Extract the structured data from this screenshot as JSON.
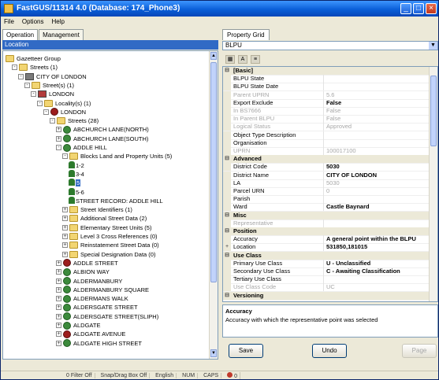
{
  "window": {
    "title": "FastGUS/11314 4.0 (Database: 174_Phone3)",
    "minimize": "_",
    "maximize": "□",
    "close": "×"
  },
  "menu": [
    "File",
    "Options",
    "Help"
  ],
  "left_tabs": [
    "Operation",
    "Management"
  ],
  "location_header": "Location",
  "tree": [
    {
      "d": 0,
      "pm": "",
      "icon": "folder",
      "label": "Gazetteer Group"
    },
    {
      "d": 1,
      "pm": "-",
      "icon": "folder",
      "label": "Streets (1)"
    },
    {
      "d": 2,
      "pm": "-",
      "icon": "house",
      "label": "CITY OF LONDON"
    },
    {
      "d": 3,
      "pm": "-",
      "icon": "folder",
      "label": "Street(s) (1)"
    },
    {
      "d": 4,
      "pm": "-",
      "icon": "house red",
      "label": "LONDON"
    },
    {
      "d": 5,
      "pm": "-",
      "icon": "folder",
      "label": "Locality(s) (1)"
    },
    {
      "d": 6,
      "pm": "-",
      "icon": "globe red",
      "label": "LONDON"
    },
    {
      "d": 7,
      "pm": "-",
      "icon": "folder",
      "label": "Streets (28)"
    },
    {
      "d": 8,
      "pm": "+",
      "icon": "globe",
      "label": "ABCHURCH LANE(NORTH)"
    },
    {
      "d": 8,
      "pm": "+",
      "icon": "globe",
      "label": "ABCHURCH LANE(SOUTH)"
    },
    {
      "d": 8,
      "pm": "-",
      "icon": "globe",
      "label": "ADDLE HILL"
    },
    {
      "d": 9,
      "pm": "-",
      "icon": "folder",
      "label": "Blocks Land and Property Units (5)"
    },
    {
      "d": 10,
      "pm": "+",
      "icon": "tree",
      "label": "1-2"
    },
    {
      "d": 10,
      "pm": "+",
      "icon": "tree",
      "label": "3-4"
    },
    {
      "d": 10,
      "pm": "+",
      "icon": "tree sel",
      "label": "5",
      "selected": true
    },
    {
      "d": 10,
      "pm": "+",
      "icon": "tree",
      "label": "5-6"
    },
    {
      "d": 10,
      "pm": "+",
      "icon": "tree",
      "label": "STREET RECORD: ADDLE HILL"
    },
    {
      "d": 9,
      "pm": "+",
      "icon": "folder",
      "label": "Street Identifiers (1)"
    },
    {
      "d": 9,
      "pm": "+",
      "icon": "folder",
      "label": "Additional Street Data (2)"
    },
    {
      "d": 9,
      "pm": "+",
      "icon": "folder",
      "label": "Elementary Street Units (5)"
    },
    {
      "d": 9,
      "pm": "+",
      "icon": "folder",
      "label": "Level 3 Cross References (0)"
    },
    {
      "d": 9,
      "pm": "+",
      "icon": "folder",
      "label": "Reinstatement Street Data (0)"
    },
    {
      "d": 9,
      "pm": "+",
      "icon": "folder",
      "label": "Special Designation Data (0)"
    },
    {
      "d": 8,
      "pm": "+",
      "icon": "globe red",
      "label": "ADDLE STREET"
    },
    {
      "d": 8,
      "pm": "+",
      "icon": "globe",
      "label": "ALBION WAY"
    },
    {
      "d": 8,
      "pm": "+",
      "icon": "globe",
      "label": "ALDERMANBURY"
    },
    {
      "d": 8,
      "pm": "+",
      "icon": "globe",
      "label": "ALDERMANBURY SQUARE"
    },
    {
      "d": 8,
      "pm": "+",
      "icon": "globe",
      "label": "ALDERMANS WALK"
    },
    {
      "d": 8,
      "pm": "+",
      "icon": "globe",
      "label": "ALDERSGATE STREET"
    },
    {
      "d": 8,
      "pm": "+",
      "icon": "globe",
      "label": "ALDERSGATE STREET(SLIPH)"
    },
    {
      "d": 8,
      "pm": "+",
      "icon": "globe",
      "label": "ALDGATE"
    },
    {
      "d": 8,
      "pm": "+",
      "icon": "globe red",
      "label": "ALDGATE AVENUE"
    },
    {
      "d": 8,
      "pm": "+",
      "icon": "globe",
      "label": "ALDGATE HIGH STREET"
    }
  ],
  "right_tab": "Property Grid",
  "selector": "BLPU",
  "grid_rows": [
    {
      "cat": true,
      "k": "[Basic]"
    },
    {
      "k": "BLPU State",
      "v": ""
    },
    {
      "k": "BLPU State Date",
      "v": ""
    },
    {
      "k": "Parent UPRN",
      "v": "5.6",
      "dimk": true,
      "dimv": true
    },
    {
      "k": "Export Exclude",
      "v": "False",
      "b": true
    },
    {
      "k": "In BS7666",
      "v": "False",
      "dimk": true,
      "dimv": true
    },
    {
      "k": "In Parent BLPU",
      "v": "False",
      "dimk": true,
      "dimv": true
    },
    {
      "k": "Logical Status",
      "v": "Approved",
      "dimk": true,
      "dimv": true
    },
    {
      "k": "Object Type Description",
      "v": ""
    },
    {
      "k": "Organisation",
      "v": ""
    },
    {
      "k": "UPRN",
      "v": "100017100",
      "dimk": true,
      "dimv": true
    },
    {
      "cat": true,
      "k": "Advanced"
    },
    {
      "k": "District Code",
      "v": "5030",
      "b": true
    },
    {
      "k": "District Name",
      "v": "CITY OF LONDON",
      "b": true
    },
    {
      "k": "LA",
      "v": "5030",
      "dimv": true
    },
    {
      "k": "Parcel URN",
      "v": "0",
      "dimv": true
    },
    {
      "k": "Parish",
      "v": ""
    },
    {
      "k": "Ward",
      "v": "Castle Baynard",
      "b": true
    },
    {
      "cat": true,
      "k": "Misc"
    },
    {
      "k": "Representative",
      "v": "",
      "dimk": true
    },
    {
      "cat": true,
      "k": "Position"
    },
    {
      "k": "Accuracy",
      "v": "A general point within the BLPU",
      "b": true
    },
    {
      "k": "Location",
      "v": "531850,181015",
      "b": true,
      "gut": "+"
    },
    {
      "cat": true,
      "k": "Use Class"
    },
    {
      "k": "Primary Use Class",
      "v": "U - Unclassified",
      "b": true
    },
    {
      "k": "Secondary Use Class",
      "v": "C - Awaiting Classification",
      "b": true
    },
    {
      "k": "Tertiary Use Class",
      "v": ""
    },
    {
      "k": "Use Class Code",
      "v": "UC",
      "dimk": true,
      "dimv": true
    },
    {
      "cat": true,
      "k": "Versioning"
    }
  ],
  "description": {
    "title": "Accuracy",
    "text": "Accuracy with which the representative point was selected"
  },
  "buttons": {
    "save": "Save",
    "undo": "Undo",
    "page": "Page"
  },
  "status": [
    "0 Filter Off",
    "Snap/Drag Box Off",
    "English",
    "NUM",
    "CAPS",
    "0"
  ]
}
